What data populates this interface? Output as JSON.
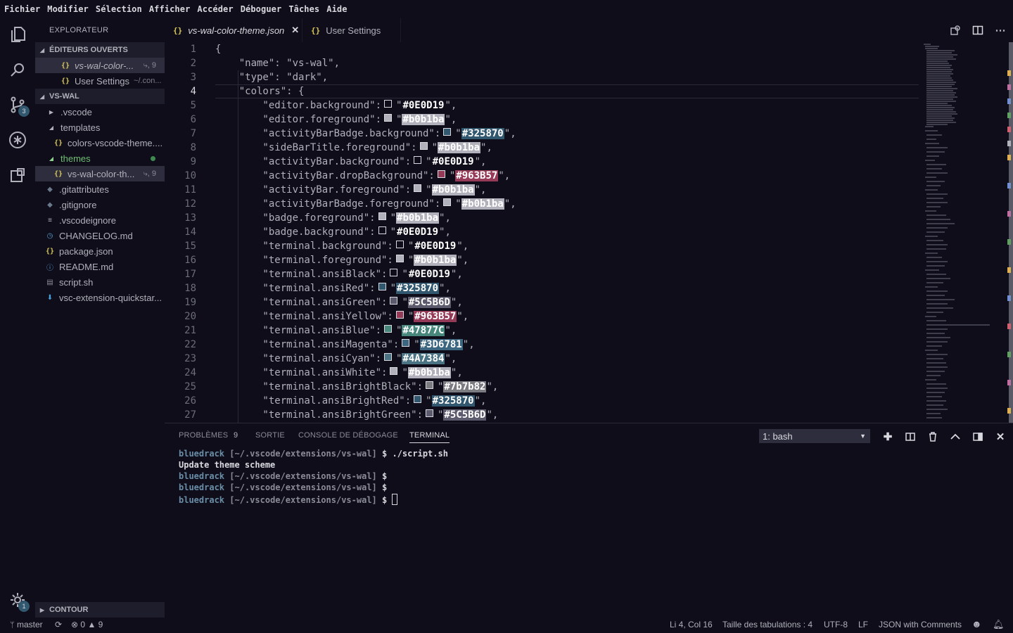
{
  "menu": [
    "Fichier",
    "Modifier",
    "Sélection",
    "Afficher",
    "Accéder",
    "Déboguer",
    "Tâches",
    "Aide"
  ],
  "activity": {
    "scm_badge": "3",
    "settings_badge": "1"
  },
  "sidebar": {
    "title": "EXPLORATEUR",
    "open_editors_title": "ÉDITEURS OUVERTS",
    "open_editors": [
      {
        "name": "vs-wal-color-...",
        "meta": "⤷, 9"
      },
      {
        "name": "User Settings",
        "desc": "~/.con..."
      }
    ],
    "project_title": "VS-WAL",
    "tree": [
      {
        "name": ".vscode"
      },
      {
        "name": "templates"
      },
      {
        "name": "colors-vscode-theme...."
      },
      {
        "name": "themes"
      },
      {
        "name": "vs-wal-color-th...",
        "meta": "⤷, 9"
      },
      {
        "name": ".gitattributes"
      },
      {
        "name": ".gitignore"
      },
      {
        "name": ".vscodeignore"
      },
      {
        "name": "CHANGELOG.md"
      },
      {
        "name": "package.json"
      },
      {
        "name": "README.md"
      },
      {
        "name": "script.sh"
      },
      {
        "name": "vsc-extension-quickstar..."
      }
    ],
    "outline_title": "CONTOUR"
  },
  "tabs": [
    {
      "label": "vs-wal-color-theme.json",
      "icon": "{ }"
    },
    {
      "label": "User Settings",
      "icon": "{ }"
    }
  ],
  "editor": {
    "lines": [
      {
        "n": "1",
        "pre": "{",
        "val": "",
        "post": ""
      },
      {
        "n": "2",
        "pre": "    \"name\": \"vs-wal\",",
        "val": "",
        "post": ""
      },
      {
        "n": "3",
        "pre": "    \"type\": \"dark\",",
        "val": "",
        "post": ""
      },
      {
        "n": "4",
        "pre": "    \"colors\": {",
        "val": "",
        "post": ""
      },
      {
        "n": "5",
        "pre": "        \"editor.background\":",
        "val": "#0E0D19",
        "post": ",",
        "color": "#0E0D19"
      },
      {
        "n": "6",
        "pre": "        \"editor.foreground\":",
        "val": "#b0b1ba",
        "post": ",",
        "color": "#b0b1ba"
      },
      {
        "n": "7",
        "pre": "        \"activityBarBadge.background\":",
        "val": "#325870",
        "post": ",",
        "color": "#325870"
      },
      {
        "n": "8",
        "pre": "        \"sideBarTitle.foreground\":",
        "val": "#b0b1ba",
        "post": ",",
        "color": "#b0b1ba"
      },
      {
        "n": "9",
        "pre": "        \"activityBar.background\":",
        "val": "#0E0D19",
        "post": ",",
        "color": "#0E0D19"
      },
      {
        "n": "10",
        "pre": "        \"activityBar.dropBackground\":",
        "val": "#963B57",
        "post": ",",
        "color": "#963B57"
      },
      {
        "n": "11",
        "pre": "        \"activityBar.foreground\":",
        "val": "#b0b1ba",
        "post": ",",
        "color": "#b0b1ba"
      },
      {
        "n": "12",
        "pre": "        \"activityBarBadge.foreground\":",
        "val": "#b0b1ba",
        "post": ",",
        "color": "#b0b1ba"
      },
      {
        "n": "13",
        "pre": "        \"badge.foreground\":",
        "val": "#b0b1ba",
        "post": ",",
        "color": "#b0b1ba"
      },
      {
        "n": "14",
        "pre": "        \"badge.background\":",
        "val": "#0E0D19",
        "post": ",",
        "color": "#0E0D19"
      },
      {
        "n": "15",
        "pre": "        \"terminal.background\":",
        "val": "#0E0D19",
        "post": ",",
        "color": "#0E0D19"
      },
      {
        "n": "16",
        "pre": "        \"terminal.foreground\":",
        "val": "#b0b1ba",
        "post": ",",
        "color": "#b0b1ba"
      },
      {
        "n": "17",
        "pre": "        \"terminal.ansiBlack\":",
        "val": "#0E0D19",
        "post": ",",
        "color": "#0E0D19"
      },
      {
        "n": "18",
        "pre": "        \"terminal.ansiRed\":",
        "val": "#325870",
        "post": ",",
        "color": "#325870"
      },
      {
        "n": "19",
        "pre": "        \"terminal.ansiGreen\":",
        "val": "#5C5B6D",
        "post": ",",
        "color": "#5C5B6D"
      },
      {
        "n": "20",
        "pre": "        \"terminal.ansiYellow\":",
        "val": "#963B57",
        "post": ",",
        "color": "#963B57"
      },
      {
        "n": "21",
        "pre": "        \"terminal.ansiBlue\":",
        "val": "#47877C",
        "post": ",",
        "color": "#47877C"
      },
      {
        "n": "22",
        "pre": "        \"terminal.ansiMagenta\":",
        "val": "#3D6781",
        "post": ",",
        "color": "#3D6781"
      },
      {
        "n": "23",
        "pre": "        \"terminal.ansiCyan\":",
        "val": "#4A7384",
        "post": ",",
        "color": "#4A7384"
      },
      {
        "n": "24",
        "pre": "        \"terminal.ansiWhite\":",
        "val": "#b0b1ba",
        "post": ",",
        "color": "#b0b1ba"
      },
      {
        "n": "25",
        "pre": "        \"terminal.ansiBrightBlack\":",
        "val": "#7b7b82",
        "post": ",",
        "color": "#7b7b82"
      },
      {
        "n": "26",
        "pre": "        \"terminal.ansiBrightRed\":",
        "val": "#325870",
        "post": ",",
        "color": "#325870"
      },
      {
        "n": "27",
        "pre": "        \"terminal.ansiBrightGreen\":",
        "val": "#5C5B6D",
        "post": ",",
        "color": "#5C5B6D"
      }
    ]
  },
  "panel": {
    "tabs": [
      "PROBLÈMES",
      "SORTIE",
      "CONSOLE DE DÉBOGAGE",
      "TERMINAL"
    ],
    "problems_count": "9",
    "terminal_select": "1: bash",
    "terminal_lines": [
      {
        "user": "bluedrack",
        "path": "[~/.vscode/extensions/vs-wal]",
        "cmd": "$ ./script.sh"
      },
      {
        "text": "Update theme scheme"
      },
      {
        "user": "bluedrack",
        "path": "[~/.vscode/extensions/vs-wal]",
        "cmd": "$"
      },
      {
        "user": "bluedrack",
        "path": "[~/.vscode/extensions/vs-wal]",
        "cmd": "$"
      },
      {
        "user": "bluedrack",
        "path": "[~/.vscode/extensions/vs-wal]",
        "cmd": "$"
      }
    ]
  },
  "status": {
    "branch": "master",
    "errors": "0",
    "warnings": "9",
    "position": "Li 4, Col 16",
    "tabs": "Taille des tabulations : 4",
    "encoding": "UTF-8",
    "eol": "LF",
    "language": "JSON with Comments"
  },
  "colors": {
    "background": "#0E0D19",
    "foreground": "#b0b1ba",
    "accent": "#325870",
    "selection": "#2e2d3d"
  }
}
